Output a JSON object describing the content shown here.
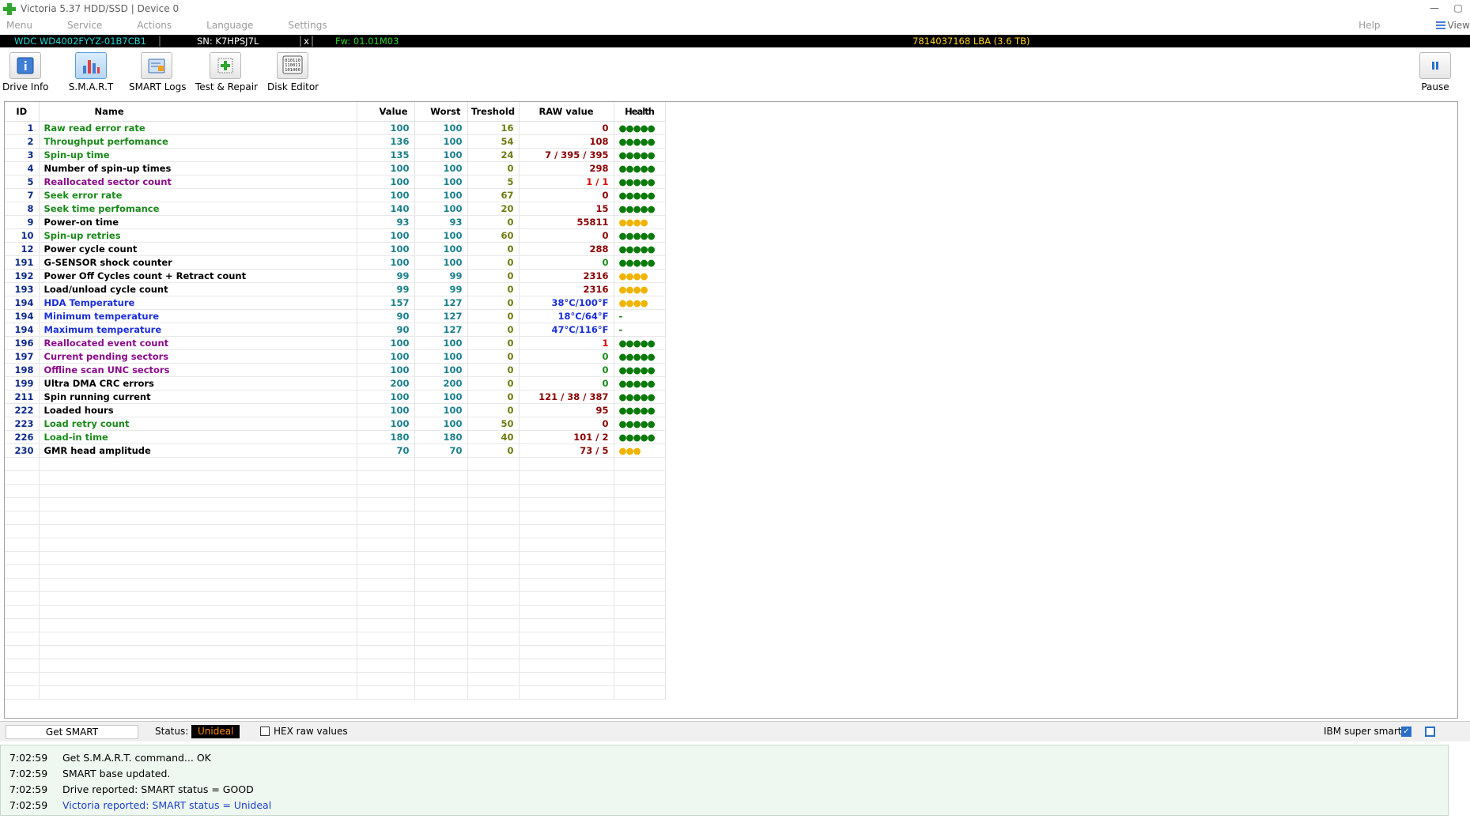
{
  "window": {
    "title": "Victoria 5.37 HDD/SSD | Device 0",
    "minimize": "—",
    "restore": "▢"
  },
  "menu": {
    "items": [
      "Menu",
      "Service",
      "Actions",
      "Language",
      "Settings"
    ],
    "help": "Help",
    "view": "View"
  },
  "device": {
    "model": "WDC WD4002FYYZ-01B7CB1",
    "serial": "SN: K7HPSJ7L",
    "close": "x",
    "firmware": "Fw: 01.01M03",
    "capacity": "7814037168 LBA (3.6 TB)"
  },
  "toolbar": {
    "drive_info": "Drive Info",
    "smart": "S.M.A.R.T",
    "smart_logs": "SMART Logs",
    "test_repair": "Test & Repair",
    "disk_editor": "Disk Editor",
    "pause": "Pause"
  },
  "colors": {
    "green": "#1a8a1a",
    "black": "#000000",
    "purple": "#8a0a8a",
    "blue": "#1b2fd8",
    "raw_red": "#8a0000",
    "raw_bright_red": "#e00000",
    "raw_green": "#1a8a1a",
    "raw_blue": "#1b2fd8",
    "health_green": "#0a7a0a",
    "health_yellow": "#f0b400"
  },
  "table": {
    "headers": {
      "id": "ID",
      "name": "Name",
      "value": "Value",
      "worst": "Worst",
      "threshold": "Treshold",
      "raw": "RAW value",
      "health": "Health"
    },
    "rows": [
      {
        "id": "1",
        "name": "Raw read error rate",
        "value": "100",
        "worst": "100",
        "threshold": "16",
        "raw": "0",
        "health": "●●●●●",
        "name_color": "green",
        "raw_color": "raw_red",
        "health_color": "health_green"
      },
      {
        "id": "2",
        "name": "Throughput perfomance",
        "value": "136",
        "worst": "100",
        "threshold": "54",
        "raw": "108",
        "health": "●●●●●",
        "name_color": "green",
        "raw_color": "raw_red",
        "health_color": "health_green"
      },
      {
        "id": "3",
        "name": "Spin-up time",
        "value": "135",
        "worst": "100",
        "threshold": "24",
        "raw": "7 / 395 / 395",
        "health": "●●●●●",
        "name_color": "green",
        "raw_color": "raw_red",
        "health_color": "health_green"
      },
      {
        "id": "4",
        "name": "Number of spin-up times",
        "value": "100",
        "worst": "100",
        "threshold": "0",
        "raw": "298",
        "health": "●●●●●",
        "name_color": "black",
        "raw_color": "raw_red",
        "health_color": "health_green"
      },
      {
        "id": "5",
        "name": "Reallocated sector count",
        "value": "100",
        "worst": "100",
        "threshold": "5",
        "raw": "1 / 1",
        "health": "●●●●●",
        "name_color": "purple",
        "raw_color": "raw_bright_red",
        "health_color": "health_green"
      },
      {
        "id": "7",
        "name": "Seek error rate",
        "value": "100",
        "worst": "100",
        "threshold": "67",
        "raw": "0",
        "health": "●●●●●",
        "name_color": "green",
        "raw_color": "raw_red",
        "health_color": "health_green"
      },
      {
        "id": "8",
        "name": "Seek time perfomance",
        "value": "140",
        "worst": "100",
        "threshold": "20",
        "raw": "15",
        "health": "●●●●●",
        "name_color": "green",
        "raw_color": "raw_red",
        "health_color": "health_green"
      },
      {
        "id": "9",
        "name": "Power-on time",
        "value": "93",
        "worst": "93",
        "threshold": "0",
        "raw": "55811",
        "health": "●●●●",
        "name_color": "black",
        "raw_color": "raw_red",
        "health_color": "health_yellow"
      },
      {
        "id": "10",
        "name": "Spin-up retries",
        "value": "100",
        "worst": "100",
        "threshold": "60",
        "raw": "0",
        "health": "●●●●●",
        "name_color": "green",
        "raw_color": "raw_red",
        "health_color": "health_green"
      },
      {
        "id": "12",
        "name": "Power cycle count",
        "value": "100",
        "worst": "100",
        "threshold": "0",
        "raw": "288",
        "health": "●●●●●",
        "name_color": "black",
        "raw_color": "raw_red",
        "health_color": "health_green"
      },
      {
        "id": "191",
        "name": "G-SENSOR shock counter",
        "value": "100",
        "worst": "100",
        "threshold": "0",
        "raw": "0",
        "health": "●●●●●",
        "name_color": "black",
        "raw_color": "raw_green",
        "health_color": "health_green"
      },
      {
        "id": "192",
        "name": "Power Off Cycles count + Retract count",
        "value": "99",
        "worst": "99",
        "threshold": "0",
        "raw": "2316",
        "health": "●●●●",
        "name_color": "black",
        "raw_color": "raw_red",
        "health_color": "health_yellow"
      },
      {
        "id": "193",
        "name": "Load/unload cycle count",
        "value": "99",
        "worst": "99",
        "threshold": "0",
        "raw": "2316",
        "health": "●●●●",
        "name_color": "black",
        "raw_color": "raw_red",
        "health_color": "health_yellow"
      },
      {
        "id": "194",
        "name": "HDA Temperature",
        "value": "157",
        "worst": "127",
        "threshold": "0",
        "raw": "38°C/100°F",
        "health": "●●●●",
        "name_color": "blue",
        "raw_color": "raw_blue",
        "health_color": "health_yellow"
      },
      {
        "id": "194",
        "name": "Minimum temperature",
        "value": "90",
        "worst": "127",
        "threshold": "0",
        "raw": "18°C/64°F",
        "health": "-",
        "name_color": "blue",
        "raw_color": "raw_blue",
        "health_color": "health_green"
      },
      {
        "id": "194",
        "name": "Maximum temperature",
        "value": "90",
        "worst": "127",
        "threshold": "0",
        "raw": "47°C/116°F",
        "health": "-",
        "name_color": "blue",
        "raw_color": "raw_blue",
        "health_color": "health_green"
      },
      {
        "id": "196",
        "name": "Reallocated event count",
        "value": "100",
        "worst": "100",
        "threshold": "0",
        "raw": "1",
        "health": "●●●●●",
        "name_color": "purple",
        "raw_color": "raw_bright_red",
        "health_color": "health_green"
      },
      {
        "id": "197",
        "name": "Current pending sectors",
        "value": "100",
        "worst": "100",
        "threshold": "0",
        "raw": "0",
        "health": "●●●●●",
        "name_color": "purple",
        "raw_color": "raw_green",
        "health_color": "health_green"
      },
      {
        "id": "198",
        "name": "Offline scan UNC sectors",
        "value": "100",
        "worst": "100",
        "threshold": "0",
        "raw": "0",
        "health": "●●●●●",
        "name_color": "purple",
        "raw_color": "raw_green",
        "health_color": "health_green"
      },
      {
        "id": "199",
        "name": "Ultra DMA CRC errors",
        "value": "200",
        "worst": "200",
        "threshold": "0",
        "raw": "0",
        "health": "●●●●●",
        "name_color": "black",
        "raw_color": "raw_green",
        "health_color": "health_green"
      },
      {
        "id": "211",
        "name": "Spin running current",
        "value": "100",
        "worst": "100",
        "threshold": "0",
        "raw": "121 / 38 / 387",
        "health": "●●●●●",
        "name_color": "black",
        "raw_color": "raw_red",
        "health_color": "health_green"
      },
      {
        "id": "222",
        "name": "Loaded hours",
        "value": "100",
        "worst": "100",
        "threshold": "0",
        "raw": "95",
        "health": "●●●●●",
        "name_color": "black",
        "raw_color": "raw_red",
        "health_color": "health_green"
      },
      {
        "id": "223",
        "name": "Load retry count",
        "value": "100",
        "worst": "100",
        "threshold": "50",
        "raw": "0",
        "health": "●●●●●",
        "name_color": "green",
        "raw_color": "raw_red",
        "health_color": "health_green"
      },
      {
        "id": "226",
        "name": "Load-in time",
        "value": "180",
        "worst": "180",
        "threshold": "40",
        "raw": "101 / 2",
        "health": "●●●●●",
        "name_color": "green",
        "raw_color": "raw_red",
        "health_color": "health_green"
      },
      {
        "id": "230",
        "name": "GMR head amplitude",
        "value": "70",
        "worst": "70",
        "threshold": "0",
        "raw": "73 / 5",
        "health": "●●●",
        "name_color": "black",
        "raw_color": "raw_red",
        "health_color": "health_yellow"
      }
    ]
  },
  "statusbar": {
    "get_smart": "Get SMART",
    "status_label": "Status:",
    "status_value": "Unideal",
    "hex_label": "HEX raw values",
    "hex_checked": false,
    "ibm_label": "IBM super smart:",
    "ibm_checked": true
  },
  "log": [
    {
      "time": "7:02:59",
      "message": "Get S.M.A.R.T. command... OK",
      "highlight": false
    },
    {
      "time": "7:02:59",
      "message": "SMART base updated.",
      "highlight": false
    },
    {
      "time": "7:02:59",
      "message": "Drive reported: SMART status = GOOD",
      "highlight": false
    },
    {
      "time": "7:02:59",
      "message": "Victoria reported: SMART status = Unideal",
      "highlight": true
    }
  ]
}
